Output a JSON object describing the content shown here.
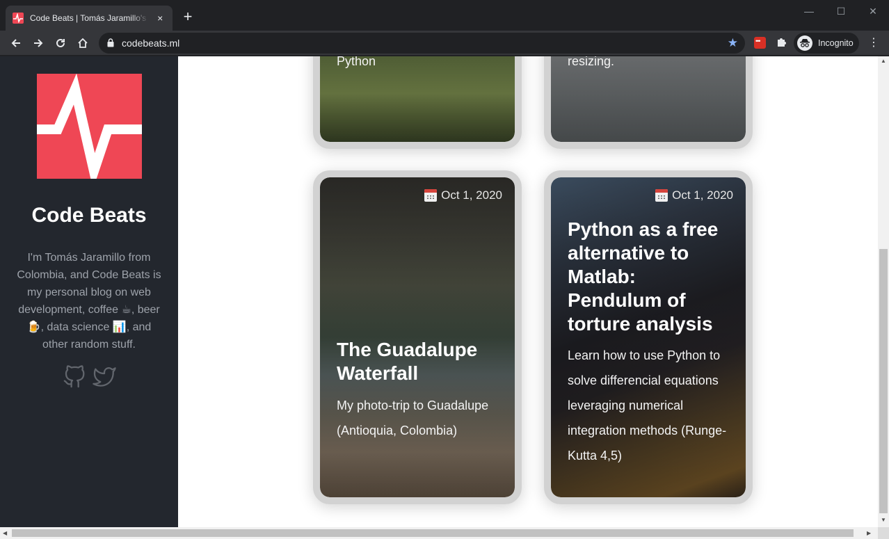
{
  "browser": {
    "tab_title": "Code Beats | Tomás Jaramillo's blog",
    "tab_close": "×",
    "new_tab": "+",
    "url": "codebeats.ml",
    "incognito_label": "Incognito",
    "window_controls": {
      "minimize": "—",
      "maximize": "☐",
      "close": "✕"
    },
    "menu": "⋮"
  },
  "sidebar": {
    "title": "Code Beats",
    "description": "I'm Tomás Jaramillo from Colombia, and Code Beats is my personal blog on web development, coffee ☕, beer 🍺, data science 📊, and other random stuff.",
    "social": [
      "github-icon",
      "twitter-icon"
    ]
  },
  "posts": [
    {
      "excerpt": "files through HTTP using Python"
    },
    {
      "excerpt": "PHP Class to perform image resizing."
    },
    {
      "date": "Oct 1, 2020",
      "title": "The Guadalupe Waterfall",
      "excerpt": "My photo-trip to Guadalupe (Antioquia, Colombia)"
    },
    {
      "date": "Oct 1, 2020",
      "title": "Python as a free alternative to Matlab: Pendulum of torture analysis",
      "excerpt": "Learn how to use Python to solve differencial equations leveraging numerical integration methods (Runge-Kutta 4,5)"
    }
  ],
  "colors": {
    "accent": "#ef4755",
    "sidebar_bg": "#23272e"
  }
}
